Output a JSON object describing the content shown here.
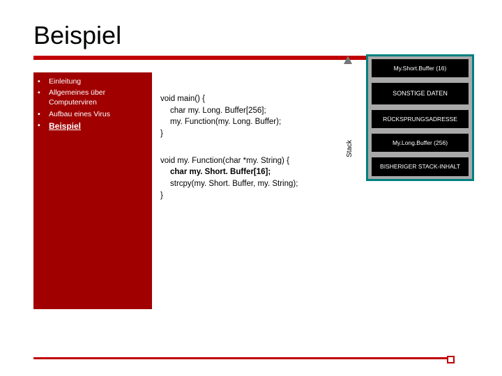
{
  "title": "Beispiel",
  "nav": {
    "items": [
      {
        "label": "Einleitung",
        "active": false
      },
      {
        "label": "Allgemeines über Computerviren",
        "active": false
      },
      {
        "label": "Aufbau eines Virus",
        "active": false
      },
      {
        "label": "Beispiel",
        "active": true
      }
    ]
  },
  "code": {
    "block1": {
      "l1": "void main() {",
      "l2": "char my. Long. Buffer[256];",
      "l3": "my. Function(my. Long. Buffer);",
      "l4": "}"
    },
    "block2": {
      "l1": "void my. Function(char *my. String) {",
      "l2": "char my. Short. Buffer[16];",
      "l3": "strcpy(my. Short. Buffer, my. String);",
      "l4": "}"
    }
  },
  "stack": {
    "label": "Stack",
    "boxes": [
      "My.Short.Buffer (16)",
      "SONSTIGE DATEN",
      "RÜCKSPRUNGSADRESSE",
      "My.Long.Buffer (256)",
      "BISHERIGER STACK-INHALT"
    ]
  }
}
